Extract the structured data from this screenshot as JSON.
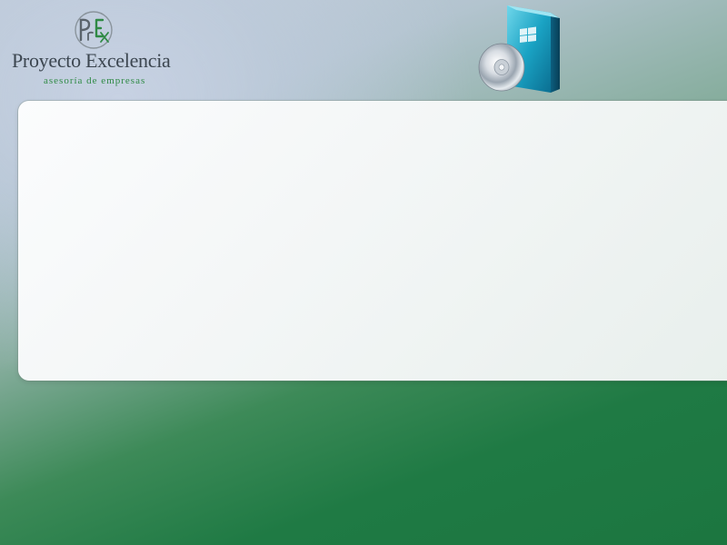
{
  "brand": {
    "name": "Proyecto Excelencia",
    "tagline": "asesoría de empresas",
    "monogram": "PrEx"
  },
  "graphics": {
    "logo_icon": "pe-monogram-icon",
    "product_icon": "software-box-with-cd-icon"
  },
  "colors": {
    "brand_green": "#2f8a45",
    "brand_text": "#3c4650",
    "background_top": "#c5cfdc",
    "background_bottom": "#1c7640",
    "panel": "#f3f6f6"
  }
}
